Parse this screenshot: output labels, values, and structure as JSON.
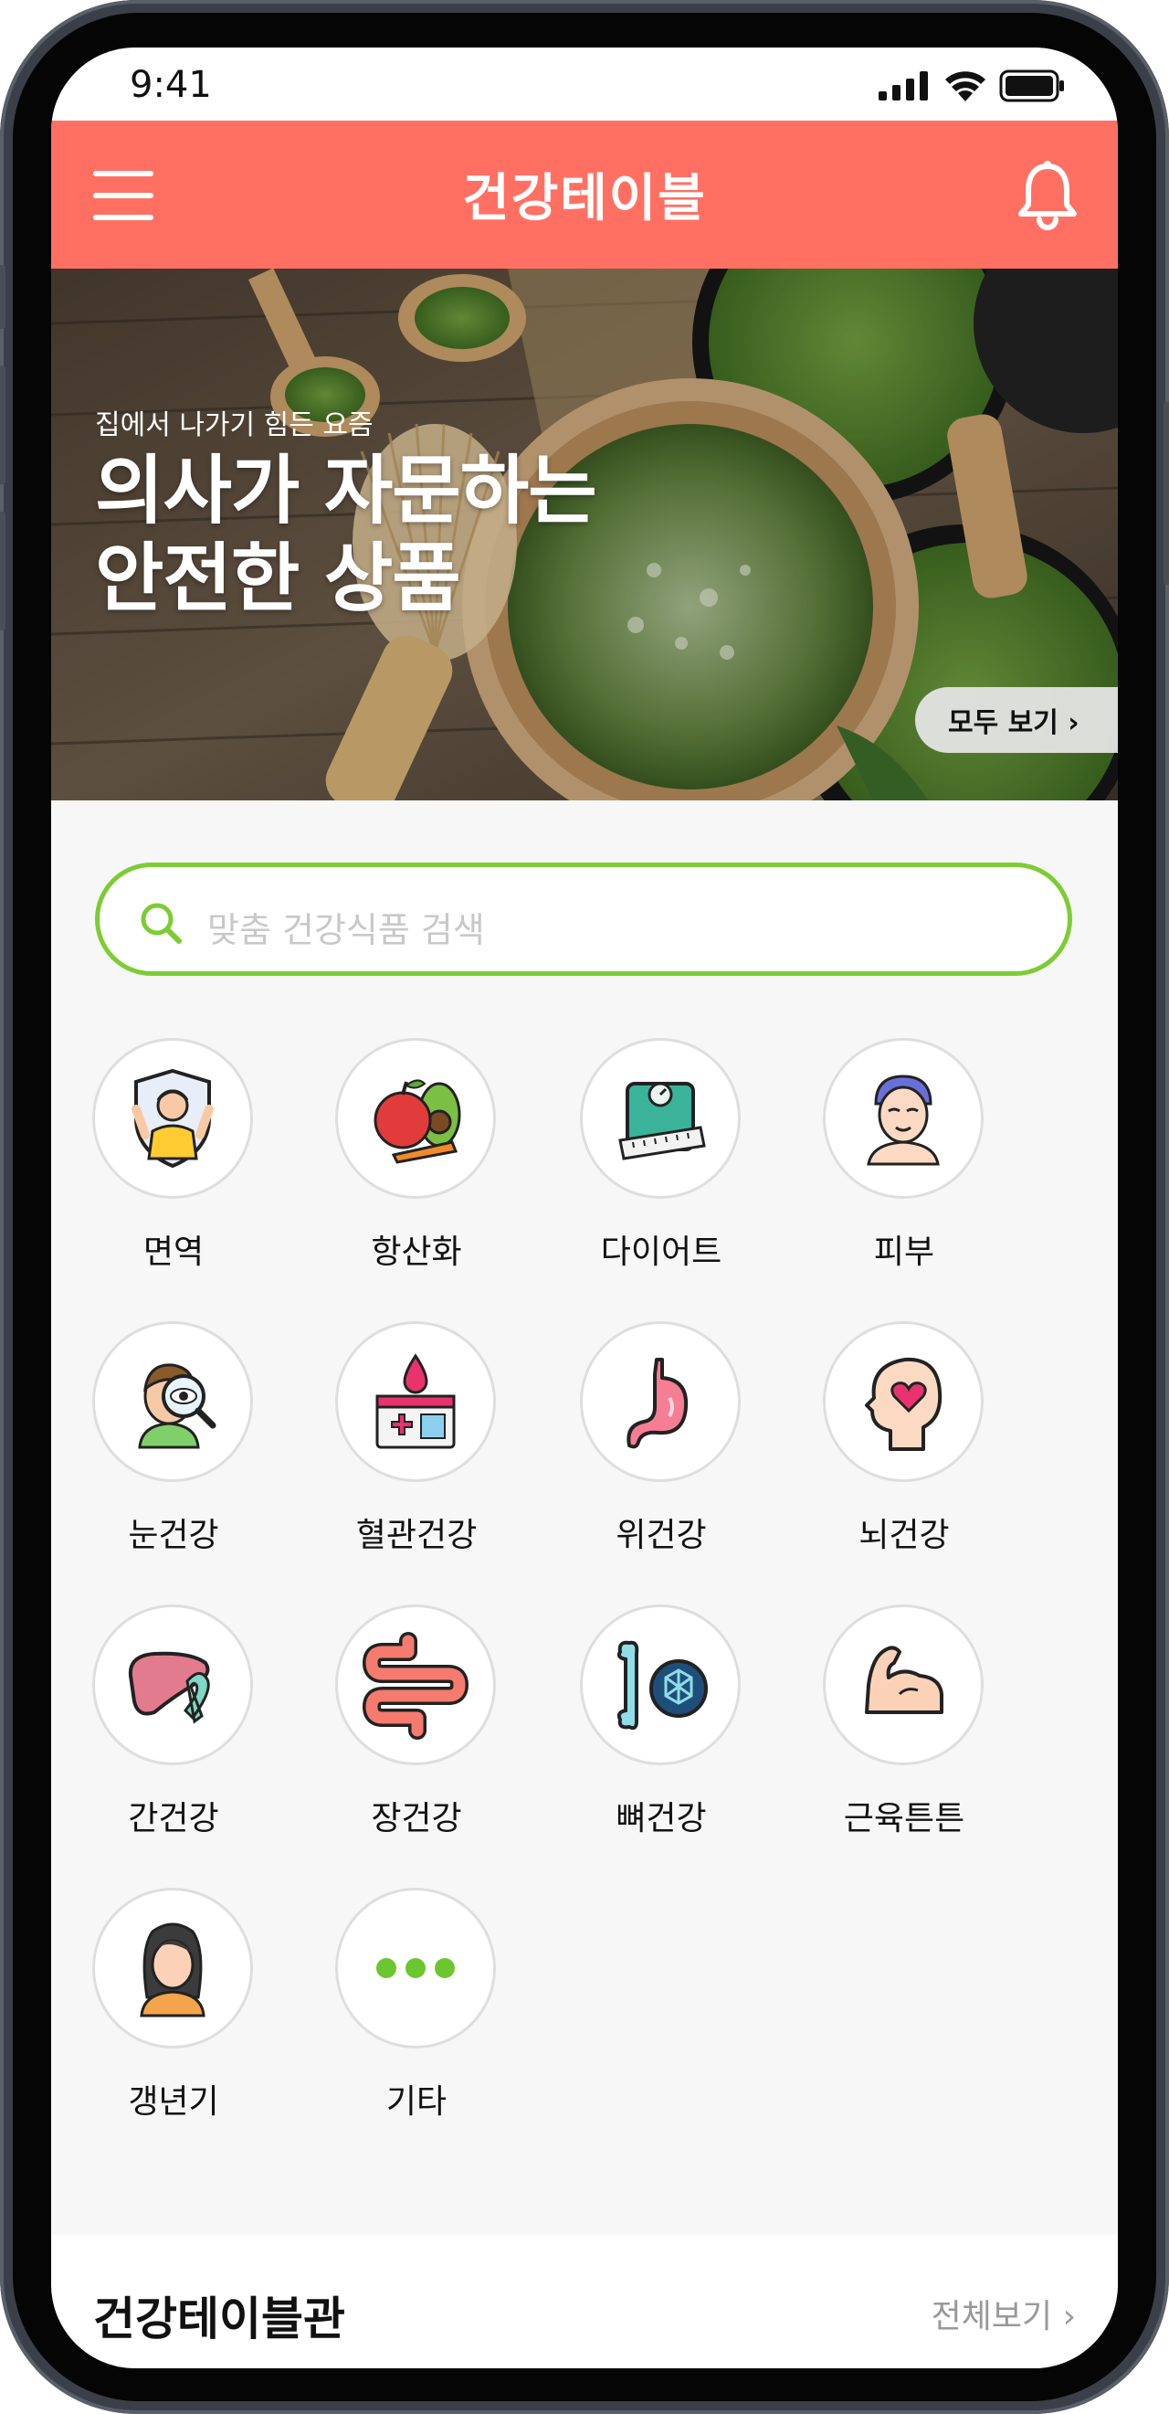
{
  "status_bar": {
    "time": "9:41"
  },
  "header": {
    "title": "건강테이블"
  },
  "hero": {
    "subtitle": "집에서 나가기 힘든 요즘",
    "title_line1": "의사가 자문하는",
    "title_line2": "안전한 상품",
    "view_all": "모두 보기 ›"
  },
  "search": {
    "placeholder": "맞춤 건강식품 검색"
  },
  "categories": [
    {
      "label": "면역",
      "icon": "immunity-icon"
    },
    {
      "label": "항산화",
      "icon": "fruit-vegetable-icon"
    },
    {
      "label": "다이어트",
      "icon": "scale-tape-icon"
    },
    {
      "label": "피부",
      "icon": "skincare-face-icon"
    },
    {
      "label": "눈건강",
      "icon": "eye-magnifier-icon"
    },
    {
      "label": "혈관건강",
      "icon": "blood-test-icon"
    },
    {
      "label": "위건강",
      "icon": "stomach-icon"
    },
    {
      "label": "뇌건강",
      "icon": "brain-heart-icon"
    },
    {
      "label": "간건강",
      "icon": "liver-ribbon-icon"
    },
    {
      "label": "장건강",
      "icon": "intestine-icon"
    },
    {
      "label": "뼈건강",
      "icon": "bone-icon"
    },
    {
      "label": "근육튼튼",
      "icon": "muscle-arm-icon"
    },
    {
      "label": "갱년기",
      "icon": "woman-icon"
    },
    {
      "label": "기타",
      "icon": "more-dots-icon"
    }
  ],
  "section": {
    "title": "건강테이블관",
    "more": "전체보기 ›"
  },
  "colors": {
    "header": "#ff7063",
    "search_border": "#7ccd34",
    "more_dots": "#6cc62f"
  }
}
